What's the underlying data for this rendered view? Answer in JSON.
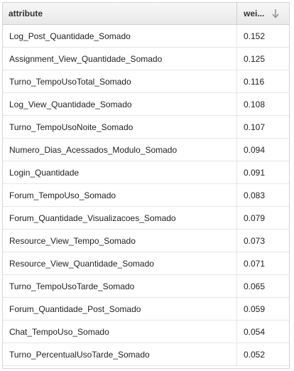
{
  "table": {
    "columns": {
      "attribute": "attribute",
      "weight": "wei..."
    },
    "sort_icon": "arrow-down-icon",
    "rows": [
      {
        "attribute": "Log_Post_Quantidade_Somado",
        "weight": "0.152"
      },
      {
        "attribute": "Assignment_View_Quantidade_Somado",
        "weight": "0.125"
      },
      {
        "attribute": "Turno_TempoUsoTotal_Somado",
        "weight": "0.116"
      },
      {
        "attribute": "Log_View_Quantidade_Somado",
        "weight": "0.108"
      },
      {
        "attribute": "Turno_TempoUsoNoite_Somado",
        "weight": "0.107"
      },
      {
        "attribute": "Numero_Dias_Acessados_Modulo_Somado",
        "weight": "0.094"
      },
      {
        "attribute": "Login_Quantidade",
        "weight": "0.091"
      },
      {
        "attribute": "Forum_TempoUso_Somado",
        "weight": "0.083"
      },
      {
        "attribute": "Forum_Quantidade_Visualizacoes_Somado",
        "weight": "0.079"
      },
      {
        "attribute": "Resource_View_Tempo_Somado",
        "weight": "0.073"
      },
      {
        "attribute": "Resource_View_Quantidade_Somado",
        "weight": "0.071"
      },
      {
        "attribute": "Turno_TempoUsoTarde_Somado",
        "weight": "0.065"
      },
      {
        "attribute": "Forum_Quantidade_Post_Somado",
        "weight": "0.059"
      },
      {
        "attribute": "Chat_TempoUso_Somado",
        "weight": "0.054"
      },
      {
        "attribute": "Turno_PercentualUsoTarde_Somado",
        "weight": "0.052"
      }
    ]
  }
}
